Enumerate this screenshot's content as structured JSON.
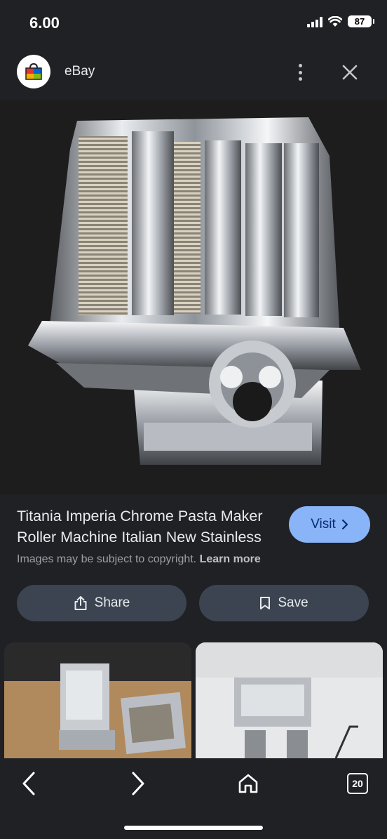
{
  "status_bar": {
    "time": "6.00",
    "battery": "87"
  },
  "header": {
    "site_name": "eBay"
  },
  "hero": {
    "icon": "pasta-maker-image"
  },
  "product": {
    "title": "Titania Imperia Chrome Pasta Maker Roller Machine Italian New Stainless",
    "visit_label": "Visit",
    "copyright_text": "Images may be subject to copyright.",
    "learn_more_label": "Learn more"
  },
  "actions": {
    "share_label": "Share",
    "save_label": "Save"
  },
  "bottom_nav": {
    "tabs_count": "20"
  },
  "colors": {
    "background": "#202124",
    "visit_button": "#8ab4f8",
    "action_button": "#3c4451"
  }
}
